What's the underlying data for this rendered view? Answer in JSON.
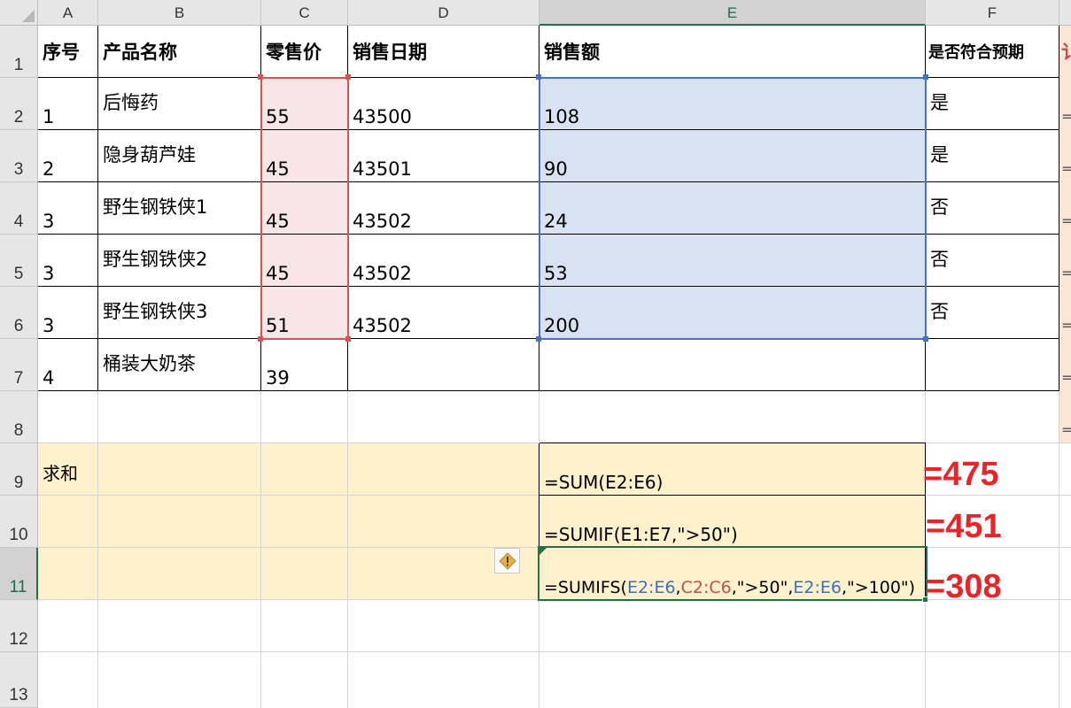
{
  "column_headers": [
    "A",
    "B",
    "C",
    "D",
    "E",
    "F"
  ],
  "row_headers": [
    "1",
    "2",
    "3",
    "4",
    "5",
    "6",
    "7",
    "8",
    "9",
    "10",
    "11",
    "12",
    "13"
  ],
  "header_row": {
    "a": "序号",
    "b": "产品名称",
    "c": "零售价",
    "d": "销售日期",
    "e": "销售额",
    "f": "是否符合预期",
    "g": "讠"
  },
  "rows": [
    {
      "a": "1",
      "b": "后悔药",
      "c": "55",
      "d": "43500",
      "e": "108",
      "f": "是",
      "g": "="
    },
    {
      "a": "2",
      "b": "隐身葫芦娃",
      "c": "45",
      "d": "43501",
      "e": "90",
      "f": "是",
      "g": "="
    },
    {
      "a": "3",
      "b": "野生钢铁侠1",
      "c": "45",
      "d": "43502",
      "e": "24",
      "f": "否",
      "g": "="
    },
    {
      "a": "3",
      "b": "野生钢铁侠2",
      "c": "45",
      "d": "43502",
      "e": "53",
      "f": "否",
      "g": "="
    },
    {
      "a": "3",
      "b": "野生钢铁侠3",
      "c": "51",
      "d": "43502",
      "e": "200",
      "f": "否",
      "g": "="
    },
    {
      "a": "4",
      "b": "桶装大奶茶",
      "c": "39",
      "d": "",
      "e": "",
      "f": "",
      "g": "="
    }
  ],
  "row8_g": "=",
  "sum_label": "求和",
  "formulas": {
    "f1": "=SUM(E2:E6)",
    "f2": "=SUMIF(E1:E7,\">50\")",
    "f3_parts": [
      "=SUMIFS(",
      "E2:E6",
      ",",
      "C2:C6",
      ",\">50\",",
      "E2:E6",
      ",\">100\")"
    ]
  },
  "annotations": {
    "r1": "=475",
    "r2": "=451",
    "r3": "=308"
  },
  "colors": {
    "c_highlight": "#f8e6e6",
    "e_highlight": "#d9e2f3",
    "sum_block": "#fff1cc",
    "annot_red": "#e8262a",
    "g_col": "#fbe5d6"
  }
}
